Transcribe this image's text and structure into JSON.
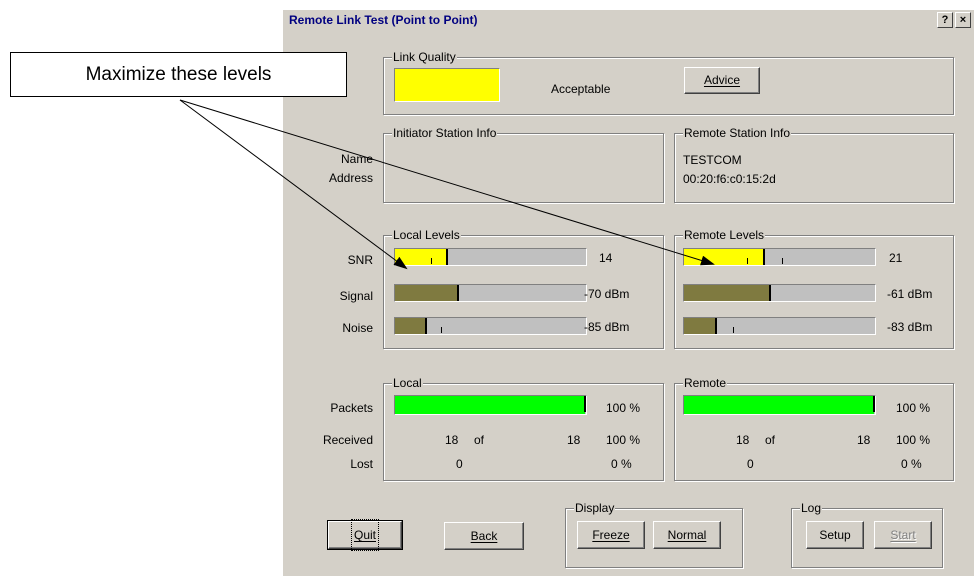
{
  "window": {
    "title": "Remote Link Test (Point to Point)",
    "help_button": "?",
    "close_button": "×"
  },
  "callout": {
    "text": "Maximize these levels"
  },
  "link_quality": {
    "legend": "Link Quality",
    "status": "Acceptable",
    "indicator_color": "#ffff00",
    "advice_button": "Advice"
  },
  "station_info": {
    "labels": {
      "name": "Name",
      "address": "Address"
    },
    "initiator": {
      "legend": "Initiator Station Info",
      "name": "",
      "address": ""
    },
    "remote": {
      "legend": "Remote Station Info",
      "name": "TESTCOM",
      "address": "00:20:f6:c0:15:2d"
    }
  },
  "levels": {
    "labels": {
      "snr": "SNR",
      "signal": "Signal",
      "noise": "Noise"
    },
    "local": {
      "legend": "Local Levels",
      "snr": {
        "value": "14",
        "level": 0.27,
        "color": "#ffff00"
      },
      "signal": {
        "value": "-70 dBm",
        "level": 0.33,
        "color": "#7f7a40"
      },
      "noise": {
        "value": "-85 dBm",
        "level": 0.16,
        "color": "#7f7a40"
      }
    },
    "remote": {
      "legend": "Remote Levels",
      "snr": {
        "value": "21",
        "level": 0.42,
        "color": "#ffff00"
      },
      "signal": {
        "value": "-61 dBm",
        "level": 0.45,
        "color": "#7f7a40"
      },
      "noise": {
        "value": "-83 dBm",
        "level": 0.17,
        "color": "#7f7a40"
      }
    }
  },
  "packets": {
    "labels": {
      "packets": "Packets",
      "received": "Received",
      "lost": "Lost",
      "of": "of"
    },
    "local": {
      "legend": "Local",
      "percent": "100 %",
      "bar_level": 1.0,
      "bar_color": "#00ff00",
      "received": "18",
      "total": "18",
      "received_pct": "100 %",
      "lost": "0",
      "lost_pct": "0 %"
    },
    "remote": {
      "legend": "Remote",
      "percent": "100 %",
      "bar_level": 1.0,
      "bar_color": "#00ff00",
      "received": "18",
      "total": "18",
      "received_pct": "100 %",
      "lost": "0",
      "lost_pct": "0 %"
    }
  },
  "buttons": {
    "quit": "Quit",
    "back": "Back"
  },
  "display": {
    "legend": "Display",
    "freeze": "Freeze",
    "normal": "Normal"
  },
  "log": {
    "legend": "Log",
    "setup": "Setup",
    "start": "Start"
  }
}
